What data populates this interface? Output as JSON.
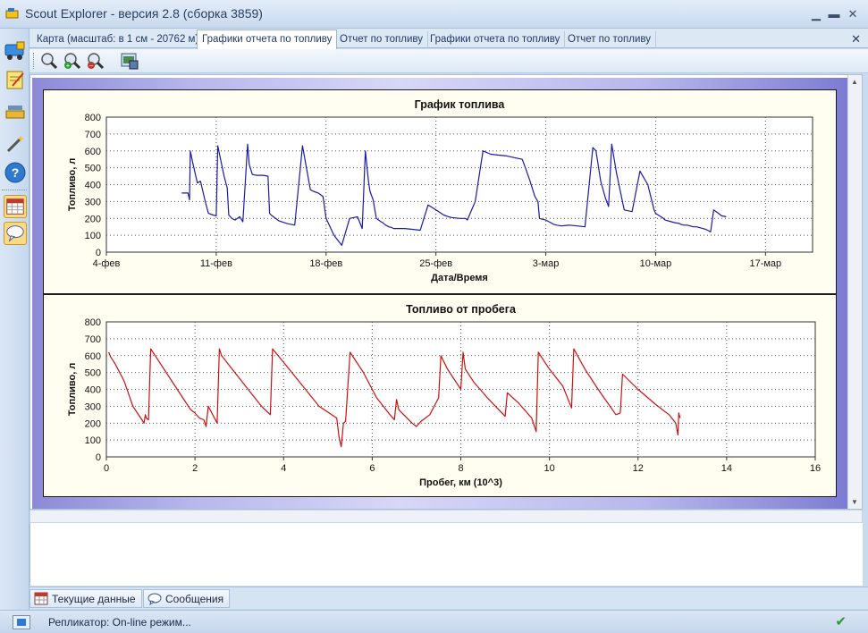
{
  "window": {
    "title": "Scout Explorer - версия 2.8 (сборка 3859)",
    "minimize": "▁",
    "maximize": "▬",
    "close": "✕"
  },
  "tabs": [
    {
      "label": "Карта (масштаб: в 1 см - 20762 м)"
    },
    {
      "label": "Графики отчета по топливу"
    },
    {
      "label": "Отчет по топливу"
    },
    {
      "label": "Графики отчета по топливу"
    },
    {
      "label": "Отчет по топливу"
    }
  ],
  "tab_close": "✕",
  "toolbar": {
    "icons": [
      "zoom-icon",
      "zoom-in-icon",
      "zoom-out-icon",
      "save-image-icon"
    ]
  },
  "bottom_tabs": [
    {
      "label": "Текущие данные",
      "icon": "calendar-icon"
    },
    {
      "label": "Сообщения",
      "icon": "message-icon"
    }
  ],
  "status": {
    "text": "Репликатор: On-line режим...",
    "check": "✔"
  },
  "colors": {
    "fuel_line": "#1a1aa8",
    "mileage_line": "#cc1010"
  },
  "chart_data": [
    {
      "type": "line",
      "title": "График топлива",
      "xlabel": "Дата/Время",
      "ylabel": "Топливо, л",
      "ylim": [
        0,
        800
      ],
      "yticks": [
        0,
        100,
        200,
        300,
        400,
        500,
        600,
        700,
        800
      ],
      "x_tick_labels": [
        "4-фев",
        "11-фев",
        "18-фев",
        "25-фев",
        "3-мар",
        "10-мар",
        "17-мар"
      ],
      "x_tick_days": [
        0,
        7,
        14,
        21,
        28,
        35,
        42
      ],
      "xlim_days": [
        0,
        45
      ],
      "grid": true,
      "series": [
        {
          "x": [
            4.8,
            5.2,
            5.3,
            5.35,
            5.5,
            5.8,
            6.0,
            6.3,
            6.5,
            6.8,
            7.0,
            7.1,
            7.5,
            7.7,
            7.8,
            8.0,
            8.2,
            8.5,
            8.7,
            9.0,
            9.1,
            9.3,
            9.6,
            10.0,
            10.3,
            10.4,
            10.5,
            11.0,
            11.5,
            12.0,
            12.5,
            12.9,
            13.0,
            13.2,
            13.5,
            13.8,
            14.0,
            14.5,
            15.0,
            15.5,
            16.0,
            16.3,
            16.5,
            16.7,
            16.8,
            17.0,
            17.2,
            17.5,
            17.6,
            17.8,
            18.0,
            18.2,
            18.3,
            18.5,
            19.0,
            19.5,
            20.0,
            20.5,
            21.0,
            21.5,
            21.8,
            22.0,
            22.5,
            22.9,
            23.0,
            23.5,
            24.0,
            24.5,
            25.0,
            25.5,
            26.0,
            26.5,
            26.7,
            27.0,
            27.3,
            27.5,
            27.6,
            28.0,
            28.2,
            28.4,
            28.5,
            28.7,
            29.0,
            29.5,
            30.0,
            30.5,
            31.0,
            31.2,
            31.5,
            31.8,
            32.0,
            32.2,
            32.5,
            33.0,
            33.5,
            34.0,
            34.5,
            34.9,
            35.0,
            35.5,
            35.6,
            36.0,
            36.2,
            36.5,
            36.6,
            36.8,
            37.0,
            37.2,
            37.4,
            37.6,
            37.8,
            38.0,
            38.2,
            38.3,
            38.5,
            38.7,
            39.0,
            39.2,
            39.5
          ],
          "y": [
            350,
            350,
            310,
            600,
            530,
            410,
            420,
            300,
            230,
            220,
            215,
            630,
            450,
            380,
            220,
            200,
            190,
            210,
            180,
            640,
            520,
            460,
            455,
            455,
            450,
            230,
            220,
            185,
            170,
            160,
            630,
            420,
            370,
            360,
            350,
            330,
            200,
            100,
            40,
            200,
            210,
            140,
            600,
            420,
            360,
            310,
            200,
            180,
            175,
            160,
            150,
            145,
            140,
            140,
            140,
            135,
            130,
            280,
            250,
            220,
            210,
            205,
            200,
            200,
            190,
            300,
            600,
            580,
            575,
            570,
            560,
            550,
            500,
            420,
            330,
            300,
            200,
            190,
            180,
            170,
            165,
            160,
            155,
            160,
            155,
            150,
            620,
            600,
            420,
            320,
            270,
            640,
            470,
            250,
            240,
            480,
            400,
            250,
            230,
            200,
            190,
            180,
            175,
            170,
            165,
            160,
            160,
            155,
            150,
            150,
            145,
            140,
            135,
            130,
            120,
            250,
            230,
            215,
            210
          ],
          "color": "#1a1aa8"
        }
      ]
    },
    {
      "type": "line",
      "title": "Топливо от пробега",
      "xlabel": "Пробег, км (10^3)",
      "ylabel": "Топливо, л",
      "ylim": [
        0,
        800
      ],
      "xlim": [
        0,
        16
      ],
      "yticks": [
        0,
        100,
        200,
        300,
        400,
        500,
        600,
        700,
        800
      ],
      "xticks": [
        0,
        2,
        4,
        6,
        8,
        10,
        12,
        14,
        16
      ],
      "grid": true,
      "series": [
        {
          "x": [
            0.05,
            0.1,
            0.2,
            0.4,
            0.6,
            0.8,
            0.85,
            0.88,
            0.9,
            0.95,
            1.0,
            1.3,
            1.6,
            1.9,
            2.0,
            2.1,
            2.2,
            2.25,
            2.3,
            2.5,
            2.55,
            2.6,
            2.9,
            3.2,
            3.5,
            3.7,
            3.75,
            4.0,
            4.4,
            4.8,
            5.2,
            5.25,
            5.3,
            5.35,
            5.4,
            5.5,
            5.8,
            6.1,
            6.4,
            6.5,
            6.55,
            6.6,
            6.9,
            7.0,
            7.1,
            7.3,
            7.5,
            7.55,
            7.7,
            8.0,
            8.05,
            8.1,
            8.3,
            8.6,
            9.0,
            9.05,
            9.3,
            9.6,
            9.7,
            9.75,
            10.0,
            10.3,
            10.5,
            10.55,
            10.8,
            11.1,
            11.5,
            11.6,
            11.65,
            12.0,
            12.4,
            12.7,
            12.85,
            12.9,
            12.92,
            12.95
          ],
          "y": [
            620,
            590,
            550,
            450,
            300,
            220,
            200,
            250,
            230,
            220,
            640,
            520,
            400,
            280,
            260,
            230,
            220,
            180,
            300,
            200,
            640,
            600,
            500,
            400,
            300,
            250,
            640,
            560,
            430,
            300,
            230,
            120,
            60,
            200,
            210,
            620,
            500,
            350,
            250,
            220,
            340,
            280,
            200,
            180,
            210,
            250,
            350,
            600,
            520,
            400,
            620,
            520,
            440,
            350,
            240,
            380,
            320,
            230,
            150,
            620,
            520,
            420,
            290,
            640,
            520,
            400,
            250,
            260,
            490,
            400,
            310,
            250,
            200,
            130,
            260,
            230
          ],
          "color": "#cc1010"
        }
      ]
    }
  ]
}
